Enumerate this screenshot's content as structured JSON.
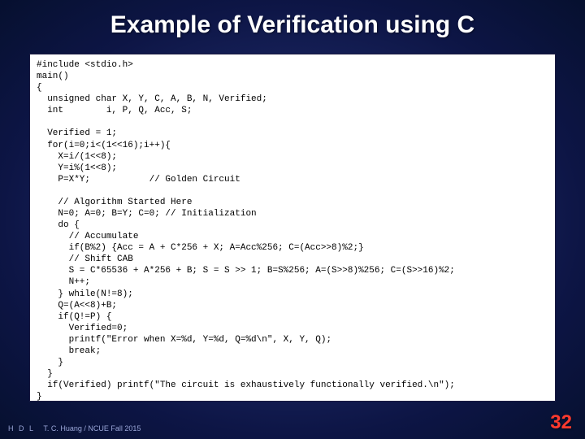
{
  "title": "Example of Verification using C",
  "code": "#include <stdio.h>\nmain()\n{\n  unsigned char X, Y, C, A, B, N, Verified;\n  int        i, P, Q, Acc, S;\n\n  Verified = 1;\n  for(i=0;i<(1<<16);i++){\n    X=i/(1<<8);\n    Y=i%(1<<8);\n    P=X*Y;           // Golden Circuit\n\n    // Algorithm Started Here\n    N=0; A=0; B=Y; C=0; // Initialization\n    do {\n      // Accumulate\n      if(B%2) {Acc = A + C*256 + X; A=Acc%256; C=(Acc>>8)%2;}\n      // Shift CAB\n      S = C*65536 + A*256 + B; S = S >> 1; B=S%256; A=(S>>8)%256; C=(S>>16)%2;\n      N++;\n    } while(N!=8);\n    Q=(A<<8)+B;\n    if(Q!=P) {\n      Verified=0;\n      printf(\"Error when X=%d, Y=%d, Q=%d\\n\", X, Y, Q);\n      break;\n    }\n  }\n  if(Verified) printf(\"The circuit is exhaustively functionally verified.\\n\");\n}",
  "footer": {
    "hdl": "H D L",
    "credit": "T. C. Huang / NCUE  Fall 2015",
    "page": "32"
  }
}
